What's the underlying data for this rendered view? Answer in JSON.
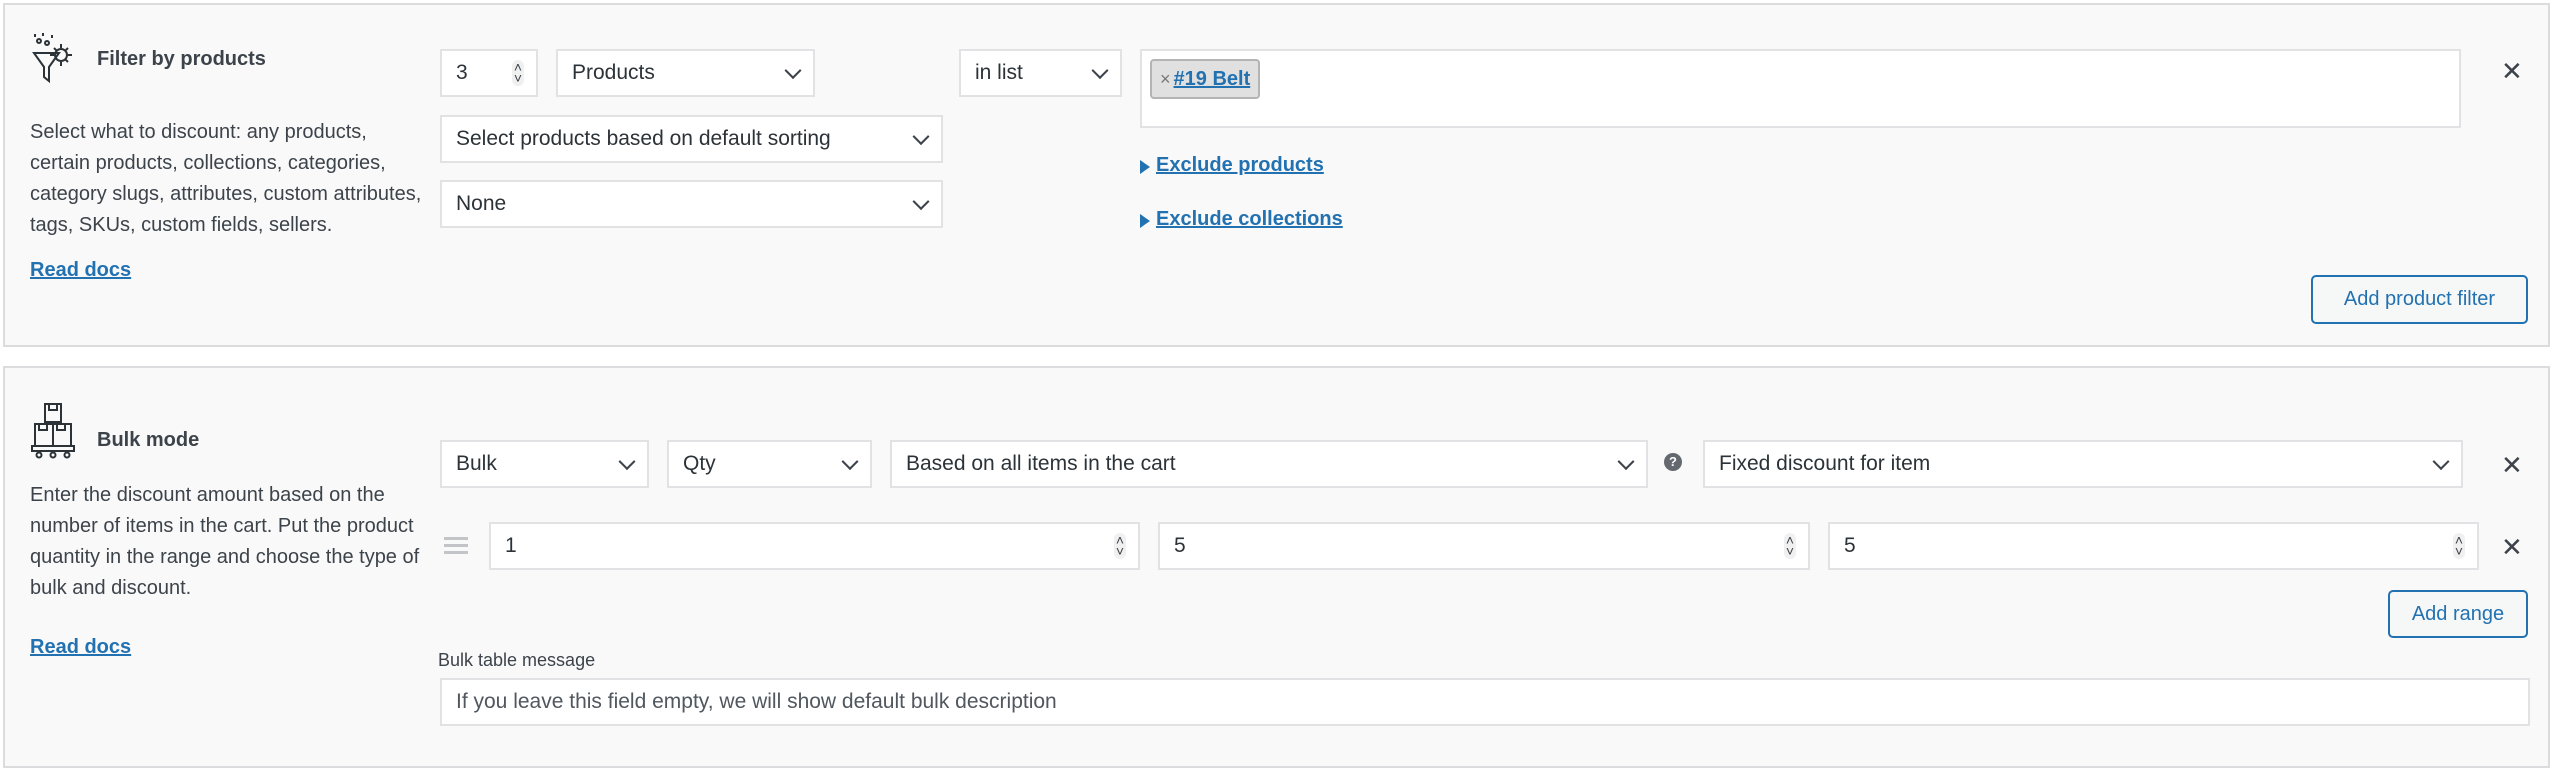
{
  "filter_panel": {
    "icon": "funnel-gear-icon",
    "title": "Filter by products",
    "description": "Select what to discount: any products, certain products, collections, categories, category slugs, attributes, custom attributes, tags, SKUs, custom fields, sellers.",
    "read_docs": "Read docs",
    "quantity": "3",
    "type_select": "Products",
    "sorting_select": "Select products based on default sorting",
    "extra_select": "None",
    "operator_select": "in list",
    "selected_items": [
      {
        "label": "#19 Belt",
        "remove": "×"
      }
    ],
    "exclude_products": "Exclude products",
    "exclude_collections": "Exclude collections",
    "add_button": "Add product filter",
    "remove": "✕"
  },
  "bulk_panel": {
    "icon": "boxes-pallet-icon",
    "title": "Bulk mode",
    "description": "Enter the discount amount based on the number of items in the cart. Put the product quantity in the range and choose the type of bulk and discount.",
    "read_docs": "Read docs",
    "mode_select": "Bulk",
    "measure_select": "Qty",
    "basis_select": "Based on all items in the cart",
    "help": "?",
    "discount_type_select": "Fixed discount for item",
    "remove": "✕",
    "ranges": [
      {
        "from": "1",
        "to": "5",
        "value": "5",
        "remove": "✕"
      }
    ],
    "add_range": "Add range",
    "message_label": "Bulk table message",
    "message_placeholder": "If you leave this field empty, we will show default bulk description"
  }
}
